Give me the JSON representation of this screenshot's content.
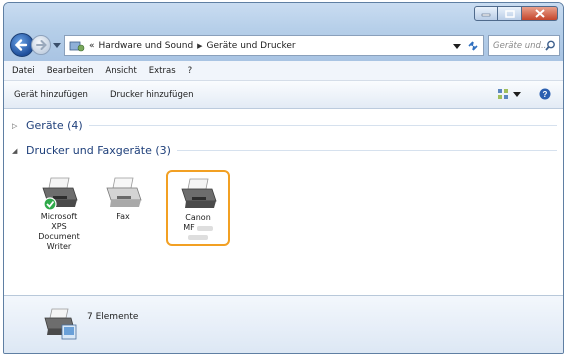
{
  "window": {
    "minimize_icon": "minimize-icon",
    "maximize_icon": "maximize-icon",
    "close_icon": "close-icon"
  },
  "address_bar": {
    "overflow": "«",
    "crumbs": [
      "Hardware und Sound",
      "Geräte und Drucker"
    ]
  },
  "search": {
    "placeholder": "Geräte und..."
  },
  "menu": {
    "items": [
      "Datei",
      "Bearbeiten",
      "Ansicht",
      "Extras",
      "?"
    ]
  },
  "toolbar": {
    "add_device": "Gerät hinzufügen",
    "add_printer": "Drucker hinzufügen"
  },
  "groups": {
    "devices": {
      "label": "Geräte (4)",
      "expanded": false
    },
    "printers": {
      "label": "Drucker und Faxgeräte (3)",
      "expanded": true
    }
  },
  "printers": [
    {
      "lines": [
        "Microsoft",
        "XPS",
        "Document",
        "Writer"
      ],
      "default": true,
      "selected": false
    },
    {
      "lines": [
        "Fax"
      ],
      "default": false,
      "selected": false
    },
    {
      "lines": [
        "Canon",
        "MF"
      ],
      "default": false,
      "selected": true
    }
  ],
  "status": {
    "count": "7 Elemente"
  },
  "colors": {
    "selection": "#f2a023",
    "group_header": "#1e3f7a",
    "default_check": "#2fa94a"
  }
}
